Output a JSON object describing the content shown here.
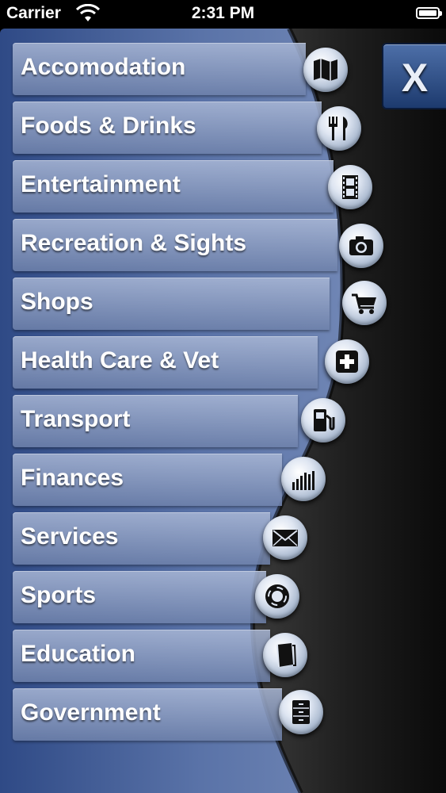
{
  "status_bar": {
    "carrier": "Carrier",
    "time": "2:31 PM"
  },
  "close_button": {
    "label": "X"
  },
  "menu": {
    "items": [
      {
        "label": "Accomodation",
        "icon": "map-icon"
      },
      {
        "label": "Foods & Drinks",
        "icon": "fork-knife-icon"
      },
      {
        "label": "Entertainment",
        "icon": "film-icon"
      },
      {
        "label": "Recreation & Sights",
        "icon": "camera-icon"
      },
      {
        "label": "Shops",
        "icon": "cart-icon"
      },
      {
        "label": "Health Care & Vet",
        "icon": "medical-cross-icon"
      },
      {
        "label": "Transport",
        "icon": "fuel-pump-icon"
      },
      {
        "label": "Finances",
        "icon": "bar-chart-icon"
      },
      {
        "label": "Services",
        "icon": "envelope-icon"
      },
      {
        "label": "Sports",
        "icon": "lifebuoy-icon"
      },
      {
        "label": "Education",
        "icon": "book-icon"
      },
      {
        "label": "Government",
        "icon": "file-cabinet-icon"
      }
    ]
  },
  "colors": {
    "panel_blue": "#4a64a0",
    "dark_band": "#1a1a1a",
    "close_blue": "#2c4c86"
  }
}
